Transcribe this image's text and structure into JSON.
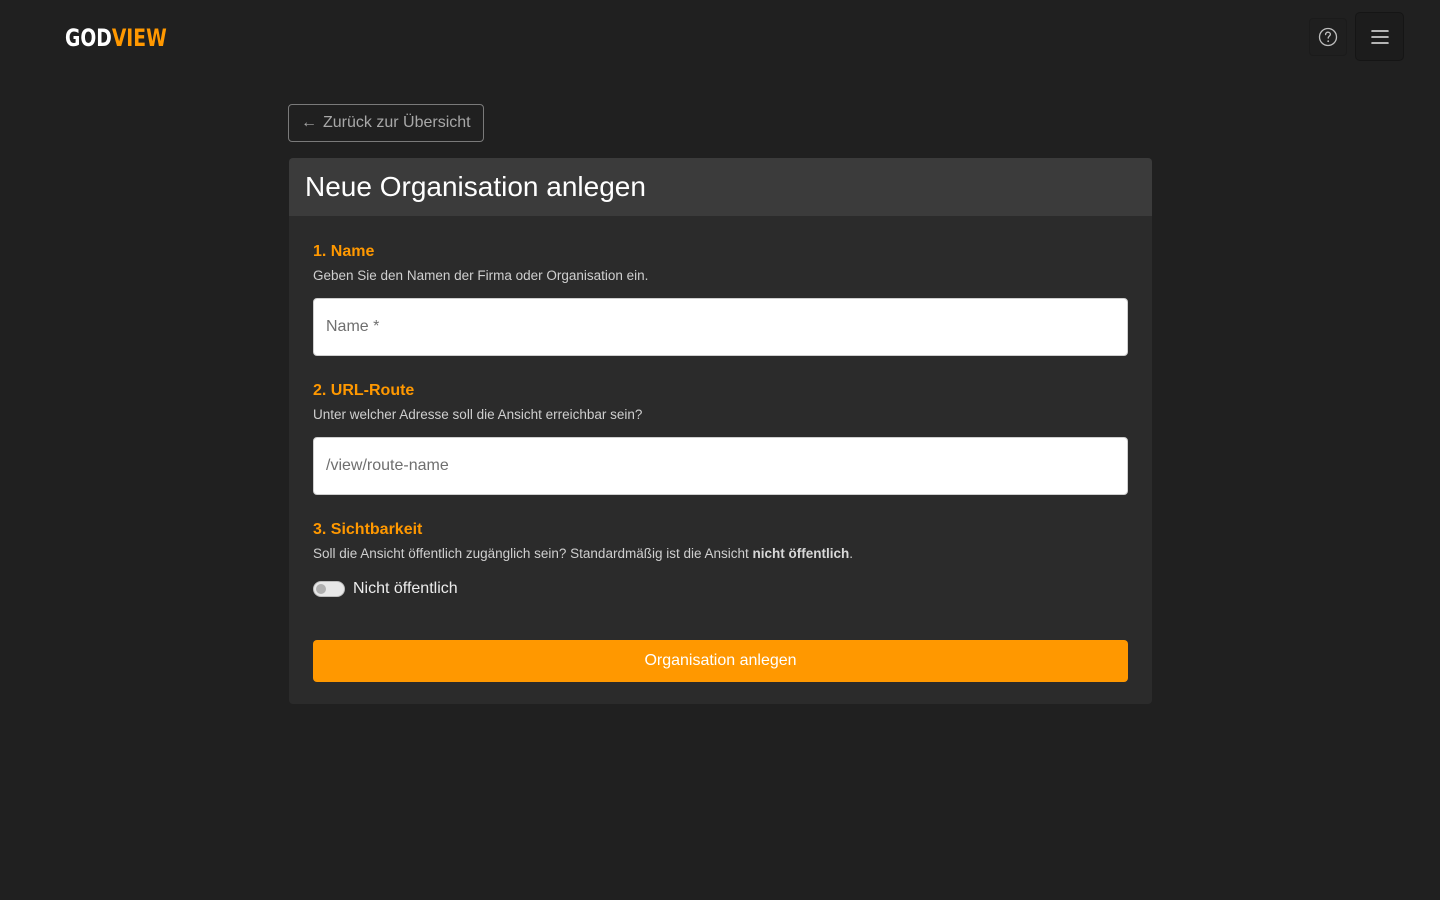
{
  "header": {
    "logo_part1": "GOD",
    "logo_part2": "VIEW",
    "help_icon": "question-circle-icon",
    "menu_icon": "hamburger-menu-icon"
  },
  "back_button": {
    "arrow_icon": "arrow-left-icon",
    "label": "Zurück zur Übersicht"
  },
  "form": {
    "title": "Neue Organisation anlegen",
    "name_section": {
      "title": "1. Name",
      "description": "Geben Sie den Namen der Firma oder Organisation ein.",
      "placeholder": "Name *",
      "value": ""
    },
    "route_section": {
      "title": "2. URL-Route",
      "description": "Unter welcher Adresse soll die Ansicht erreichbar sein?",
      "placeholder": "/view/route-name",
      "value": ""
    },
    "visibility_section": {
      "title": "3. Sichtbarkeit",
      "description_prefix": "Soll die Ansicht öffentlich zugänglich sein? Standardmäßig ist die Ansicht ",
      "description_bold": "nicht öffentlich",
      "description_suffix": ".",
      "toggle_state": false,
      "toggle_label": "Nicht öffentlich"
    },
    "submit_label": "Organisation anlegen"
  },
  "colors": {
    "accent": "#ff9800",
    "background": "#202020",
    "card": "#2b2b2b",
    "card_header": "#3b3b3b"
  }
}
